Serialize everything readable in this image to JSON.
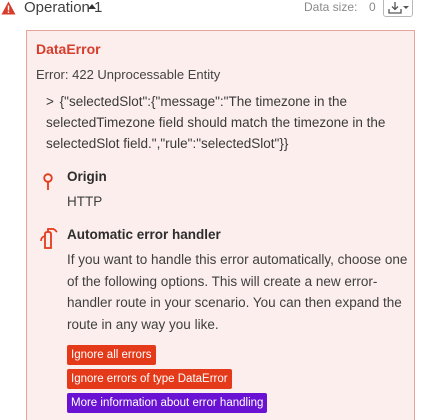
{
  "header": {
    "title": "Operation 1",
    "data_size_label": "Data size:",
    "data_size_value": "0"
  },
  "error": {
    "type": "DataError",
    "status": "Error: 422 Unprocessable Entity",
    "chevron": ">",
    "json_message": "{\"selectedSlot\":{\"message\":\"The timezone in the selectedTimezone field should match the timezone in the selectedSlot field.\",\"rule\":\"selectedSlot\"}}"
  },
  "origin": {
    "title": "Origin",
    "value": "HTTP"
  },
  "handler": {
    "title": "Automatic error handler",
    "description": "If you want to handle this error automatically, choose one of the following options. This will create a new error-handler route in your scenario. You can then expand the route in any way you like.",
    "buttons": {
      "ignore_all": "Ignore all errors",
      "ignore_type": "Ignore errors of type DataError",
      "more_info": "More information about error handling"
    }
  },
  "colors": {
    "error_red": "#d73c2c",
    "box_background": "#fbeeed",
    "button_red": "#e53a1a",
    "button_purple": "#6a12d4"
  },
  "icons": {
    "warning": "warning-triangle-icon",
    "download": "download-icon",
    "origin": "map-pin-icon",
    "handler": "fire-extinguisher-icon"
  }
}
